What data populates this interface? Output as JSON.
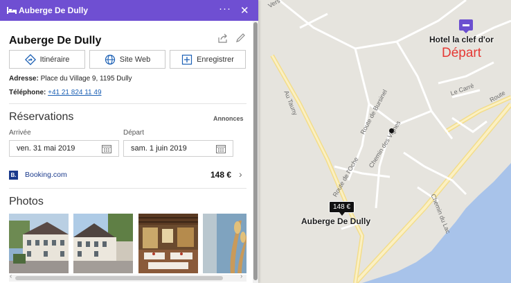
{
  "panel": {
    "header_title": "Auberge De Dully",
    "name": "Auberge De Dully",
    "buttons": {
      "route": "Itinéraire",
      "website": "Site Web",
      "save": "Enregistrer"
    },
    "address_label": "Adresse:",
    "address": "Place du Village 9, 1195 Dully",
    "phone_label": "Téléphone:",
    "phone": "+41 21 824 11 49",
    "reservations": {
      "title": "Réservations",
      "ads_label": "Annonces",
      "arrival_label": "Arrivée",
      "arrival": "ven. 31 mai 2019",
      "departure_label": "Départ",
      "departure": "sam. 1 juin 2019",
      "provider_badge": "B.",
      "provider": "Booking.com",
      "price": "148 €"
    },
    "photos_title": "Photos"
  },
  "map": {
    "hotel_label": "Hotel la clef d'or",
    "depart_label": "Départ",
    "auberge_label": "Auberge De Dully",
    "price_pin": "148 €",
    "roads": {
      "au_tauny": "Au Tauny",
      "route_bursinel": "Route de Bursinel",
      "chemin_vignes": "Chemin des Vignes",
      "route_oche": "Route de l'Oche",
      "chemin_lac": "Chemin du Lac",
      "le_carre": "Le Carré",
      "route": "Route",
      "vers": "Vers"
    }
  },
  "colors": {
    "header": "#6f4fd2",
    "link": "#1a5fb4",
    "depart": "#e53935",
    "lake": "#a8c3ea",
    "road_major": "#f8e7a8"
  }
}
